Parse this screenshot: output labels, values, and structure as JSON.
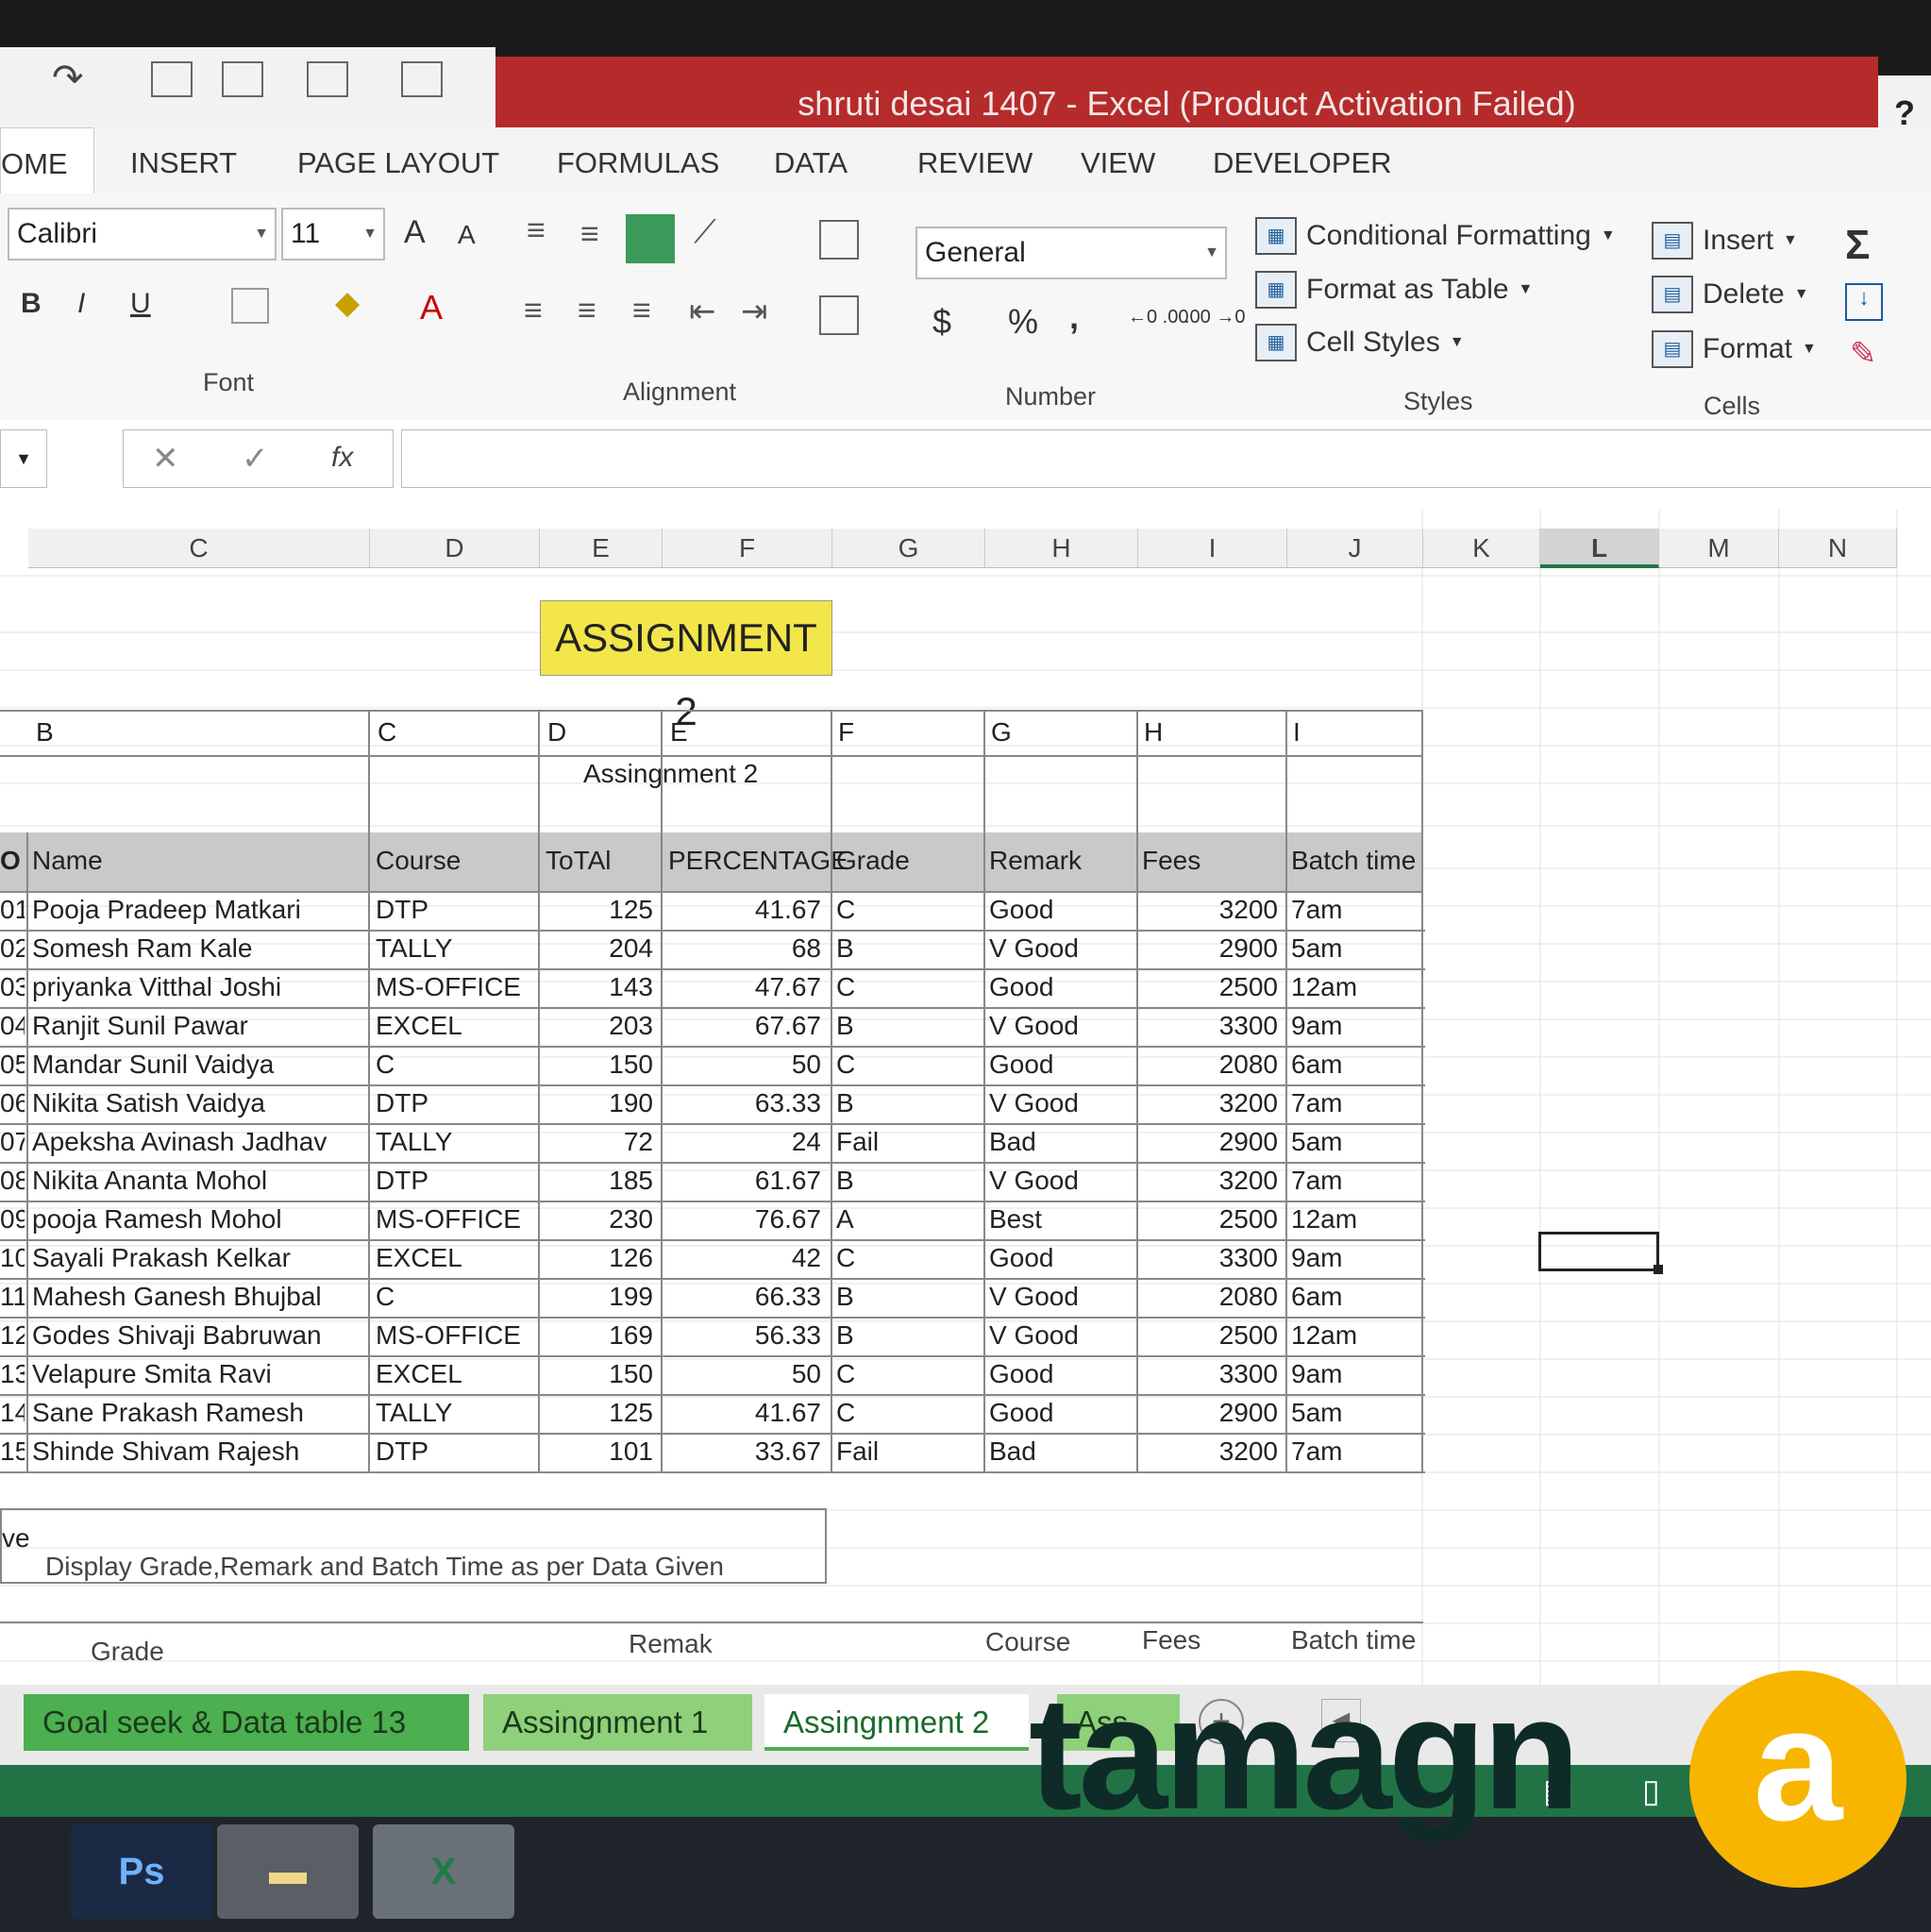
{
  "window": {
    "title": "shruti desai 1407 -  Excel (Product Activation Failed)",
    "help": "?"
  },
  "ribbon_tabs": [
    "OME",
    "INSERT",
    "PAGE LAYOUT",
    "FORMULAS",
    "DATA",
    "REVIEW",
    "VIEW",
    "DEVELOPER"
  ],
  "font": {
    "name": "Calibri",
    "size": "11",
    "bold": "B",
    "italic": "I",
    "underline": "U",
    "grow": "A",
    "shrink": "A",
    "color": "A"
  },
  "groups": {
    "font": "Font",
    "alignment": "Alignment",
    "number": "Number",
    "styles": "Styles",
    "cells": "Cells"
  },
  "number_format": "General",
  "number_symbols": {
    "currency": "$",
    "percent": "%",
    "comma": ",",
    "inc": "←0 .00",
    "dec": ".00 →0"
  },
  "styles": {
    "conditional": "Conditional Formatting",
    "table": "Format as Table",
    "cell": "Cell Styles"
  },
  "cells": {
    "insert": "Insert",
    "delete": "Delete",
    "format": "Format"
  },
  "formula_bar": {
    "cancel": "✕",
    "enter": "✓",
    "fx": "fx"
  },
  "columns": [
    "C",
    "D",
    "E",
    "F",
    "G",
    "H",
    "I",
    "J",
    "K",
    "L",
    "M",
    "N"
  ],
  "assignment_title": "ASSIGNMENT 2",
  "inner_letters": [
    "B",
    "C",
    "D",
    "E",
    "F",
    "G",
    "H",
    "I"
  ],
  "subtitle": "Assingnment 2",
  "table_headers": [
    "O",
    "Name",
    "Course",
    "ToTAl",
    "PERCENTAGE",
    "Grade",
    "Remark",
    "Fees",
    "Batch time"
  ],
  "rows": [
    {
      "no": "01",
      "name": "Pooja Pradeep Matkari",
      "course": "DTP",
      "total": "125",
      "pct": "41.67",
      "grade": "C",
      "remark": "Good",
      "fees": "3200",
      "batch": "7am"
    },
    {
      "no": "02",
      "name": "Somesh Ram Kale",
      "course": "TALLY",
      "total": "204",
      "pct": "68",
      "grade": "B",
      "remark": "V Good",
      "fees": "2900",
      "batch": "5am"
    },
    {
      "no": "03",
      "name": "priyanka Vitthal Joshi",
      "course": "MS-OFFICE",
      "total": "143",
      "pct": "47.67",
      "grade": "C",
      "remark": "Good",
      "fees": "2500",
      "batch": "12am"
    },
    {
      "no": "04",
      "name": "Ranjit Sunil Pawar",
      "course": "EXCEL",
      "total": "203",
      "pct": "67.67",
      "grade": "B",
      "remark": "V Good",
      "fees": "3300",
      "batch": "9am"
    },
    {
      "no": "05",
      "name": "Mandar Sunil Vaidya",
      "course": "C",
      "total": "150",
      "pct": "50",
      "grade": "C",
      "remark": "Good",
      "fees": "2080",
      "batch": "6am"
    },
    {
      "no": "06",
      "name": "Nikita Satish Vaidya",
      "course": "DTP",
      "total": "190",
      "pct": "63.33",
      "grade": "B",
      "remark": "V Good",
      "fees": "3200",
      "batch": "7am"
    },
    {
      "no": "07",
      "name": "Apeksha Avinash Jadhav",
      "course": "TALLY",
      "total": "72",
      "pct": "24",
      "grade": "Fail",
      "remark": "Bad",
      "fees": "2900",
      "batch": "5am"
    },
    {
      "no": "08",
      "name": "Nikita Ananta Mohol",
      "course": "DTP",
      "total": "185",
      "pct": "61.67",
      "grade": "B",
      "remark": "V Good",
      "fees": "3200",
      "batch": "7am"
    },
    {
      "no": "09",
      "name": "pooja Ramesh Mohol",
      "course": "MS-OFFICE",
      "total": "230",
      "pct": "76.67",
      "grade": "A",
      "remark": "Best",
      "fees": "2500",
      "batch": "12am"
    },
    {
      "no": "10",
      "name": "Sayali Prakash Kelkar",
      "course": "EXCEL",
      "total": "126",
      "pct": "42",
      "grade": "C",
      "remark": "Good",
      "fees": "3300",
      "batch": "9am"
    },
    {
      "no": "11",
      "name": "Mahesh Ganesh Bhujbal",
      "course": "C",
      "total": "199",
      "pct": "66.33",
      "grade": "B",
      "remark": "V Good",
      "fees": "2080",
      "batch": "6am"
    },
    {
      "no": "12",
      "name": "Godes Shivaji Babruwan",
      "course": "MS-OFFICE",
      "total": "169",
      "pct": "56.33",
      "grade": "B",
      "remark": "V Good",
      "fees": "2500",
      "batch": "12am"
    },
    {
      "no": "13",
      "name": "Velapure Smita Ravi",
      "course": "EXCEL",
      "total": "150",
      "pct": "50",
      "grade": "C",
      "remark": "Good",
      "fees": "3300",
      "batch": "9am"
    },
    {
      "no": "14",
      "name": "Sane Prakash Ramesh",
      "course": "TALLY",
      "total": "125",
      "pct": "41.67",
      "grade": "C",
      "remark": "Good",
      "fees": "2900",
      "batch": "5am"
    },
    {
      "no": "15",
      "name": "Shinde Shivam Rajesh",
      "course": "DTP",
      "total": "101",
      "pct": "33.67",
      "grade": "Fail",
      "remark": "Bad",
      "fees": "3200",
      "batch": "7am"
    }
  ],
  "objective_label": "ve",
  "instruction": "Display Grade,Remark and Batch Time as per Data Given",
  "bottom_headers": {
    "grade": "Grade",
    "remak": "Remak",
    "course": "Course",
    "fees": "Fees",
    "batch": "Batch time"
  },
  "sheet_tabs": [
    "Goal seek & Data table 13",
    "Assingnment 1",
    "Assingnment 2",
    "Ass ..."
  ],
  "taskbar": {
    "ps": "Ps",
    "excel": "X"
  },
  "watermark": {
    "text": "tamagn",
    "accent": "a"
  },
  "colors": {
    "title_bar": "#b52b2b",
    "highlight": "#f2e64a",
    "sheet_tab_green": "#4caf50",
    "status_green": "#217346"
  }
}
